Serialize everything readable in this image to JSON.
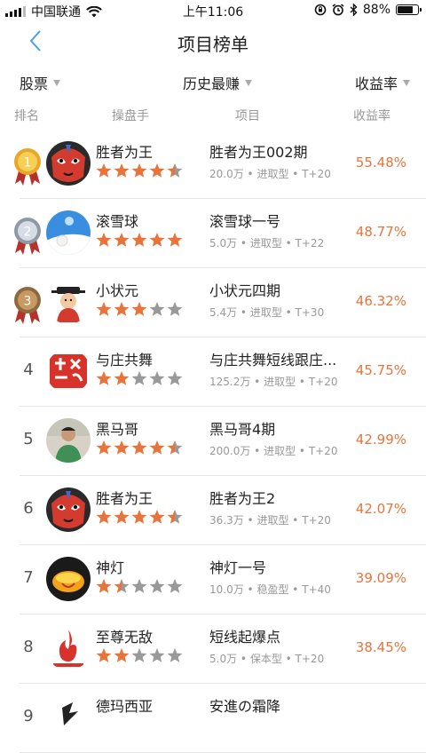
{
  "status": {
    "carrier": "中国联通",
    "time": "上午11:06",
    "battery": "88%",
    "battery_level": 0.88
  },
  "nav": {
    "title": "项目榜单"
  },
  "filters": {
    "market": "股票",
    "period": "历史最赚",
    "sort": "收益率"
  },
  "headers": {
    "rank": "排名",
    "trader": "操盘手",
    "project": "项目",
    "yield": "收益率"
  },
  "colors": {
    "accent": "#e8743b",
    "star_filled": "#e8743b",
    "star_empty": "#999999",
    "back": "#4aa0e6"
  },
  "rows": [
    {
      "rank": "1",
      "medal": "gold",
      "name": "胜者为王",
      "stars": 4.5,
      "project": "胜者为王002期",
      "amount": "20.0万",
      "risk": "进取型",
      "period": "T+20",
      "yield": "55.48%",
      "avatar": "opera-mask"
    },
    {
      "rank": "2",
      "medal": "silver",
      "name": "滚雪球",
      "stars": 5,
      "project": "滚雪球一号",
      "amount": "5.0万",
      "risk": "进取型",
      "period": "T+22",
      "yield": "48.77%",
      "avatar": "snowball"
    },
    {
      "rank": "3",
      "medal": "bronze",
      "name": "小状元",
      "stars": 3,
      "project": "小状元四期",
      "amount": "5.4万",
      "risk": "进取型",
      "period": "T+30",
      "yield": "46.32%",
      "avatar": "scholar"
    },
    {
      "rank": "4",
      "medal": "",
      "name": "与庄共舞",
      "stars": 2,
      "project": "与庄共舞短线跟庄...",
      "amount": "125.2万",
      "risk": "进取型",
      "period": "T+20",
      "yield": "45.75%",
      "avatar": "red-calligraphy"
    },
    {
      "rank": "5",
      "medal": "",
      "name": "黑马哥",
      "stars": 4.5,
      "project": "黑马哥4期",
      "amount": "200.0万",
      "risk": "进取型",
      "period": "T+20",
      "yield": "42.99%",
      "avatar": "portrait"
    },
    {
      "rank": "6",
      "medal": "",
      "name": "胜者为王",
      "stars": 4.5,
      "project": "胜者为王2",
      "amount": "36.3万",
      "risk": "进取型",
      "period": "T+20",
      "yield": "42.07%",
      "avatar": "opera-mask"
    },
    {
      "rank": "7",
      "medal": "",
      "name": "神灯",
      "stars": 1.5,
      "project": "神灯一号",
      "amount": "10.0万",
      "risk": "稳盈型",
      "period": "T+40",
      "yield": "39.09%",
      "avatar": "magic-lamp"
    },
    {
      "rank": "8",
      "medal": "",
      "name": "至尊无敌",
      "stars": 2,
      "project": "短线起爆点",
      "amount": "5.0万",
      "risk": "保本型",
      "period": "T+20",
      "yield": "38.45%",
      "avatar": "flame-logo"
    },
    {
      "rank": "9",
      "medal": "",
      "name": "德玛西亚",
      "stars": 0,
      "project": "安進の霜降",
      "amount": "",
      "risk": "",
      "period": "",
      "yield": "",
      "avatar": "dark-logo"
    }
  ]
}
